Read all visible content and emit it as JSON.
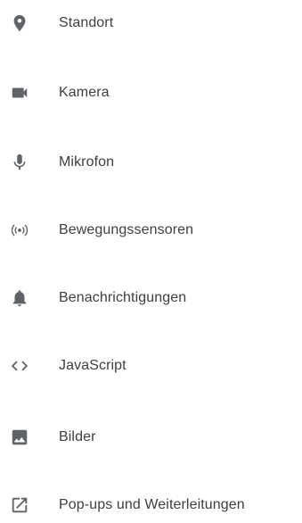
{
  "permissions": {
    "items": [
      {
        "label": "Standort",
        "icon": "location-pin-icon"
      },
      {
        "label": "Kamera",
        "icon": "video-camera-icon"
      },
      {
        "label": "Mikrofon",
        "icon": "microphone-icon"
      },
      {
        "label": "Bewegungssensoren",
        "icon": "motion-sensor-icon"
      },
      {
        "label": "Benachrichtigungen",
        "icon": "bell-icon"
      },
      {
        "label": "JavaScript",
        "icon": "code-icon"
      },
      {
        "label": "Bilder",
        "icon": "image-icon"
      },
      {
        "label": "Pop-ups und Weiterleitungen",
        "icon": "open-in-new-icon"
      }
    ]
  },
  "colors": {
    "icon": "#5f6368",
    "text": "#3c4043",
    "background": "#ffffff"
  }
}
